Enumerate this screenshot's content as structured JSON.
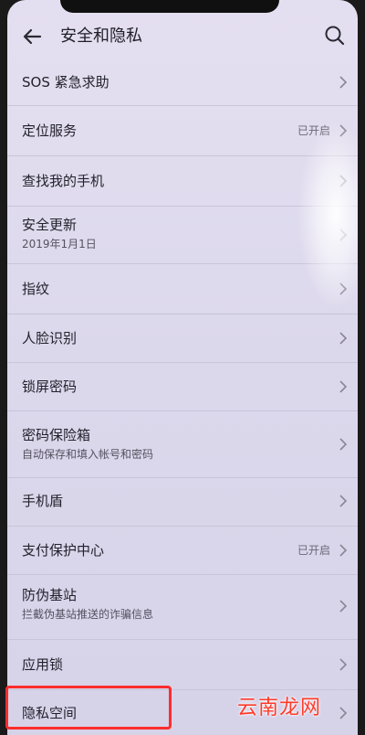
{
  "header": {
    "title": "安全和隐私",
    "back_icon": "arrow-left-icon",
    "search_icon": "search-icon"
  },
  "list": [
    {
      "label": "SOS 紧急求助",
      "sub": "",
      "status": ""
    },
    {
      "label": "定位服务",
      "sub": "",
      "status": "已开启"
    },
    {
      "label": "查找我的手机",
      "sub": "",
      "status": ""
    },
    {
      "label": "安全更新",
      "sub": "2019年1月1日",
      "status": ""
    },
    {
      "label": "指纹",
      "sub": "",
      "status": ""
    },
    {
      "label": "人脸识别",
      "sub": "",
      "status": ""
    },
    {
      "label": "锁屏密码",
      "sub": "",
      "status": ""
    },
    {
      "label": "密码保险箱",
      "sub": "自动保存和填入帐号和密码",
      "status": ""
    },
    {
      "label": "手机盾",
      "sub": "",
      "status": ""
    },
    {
      "label": "支付保护中心",
      "sub": "",
      "status": "已开启"
    },
    {
      "label": "防伪基站",
      "sub": "拦截伪基站推送的诈骗信息",
      "status": ""
    },
    {
      "label": "应用锁",
      "sub": "",
      "status": ""
    },
    {
      "label": "隐私空间",
      "sub": "",
      "status": ""
    }
  ],
  "watermark": "云南龙网",
  "colors": {
    "highlight_box": "#ff2d2d",
    "watermark": "#ff3a2a"
  }
}
